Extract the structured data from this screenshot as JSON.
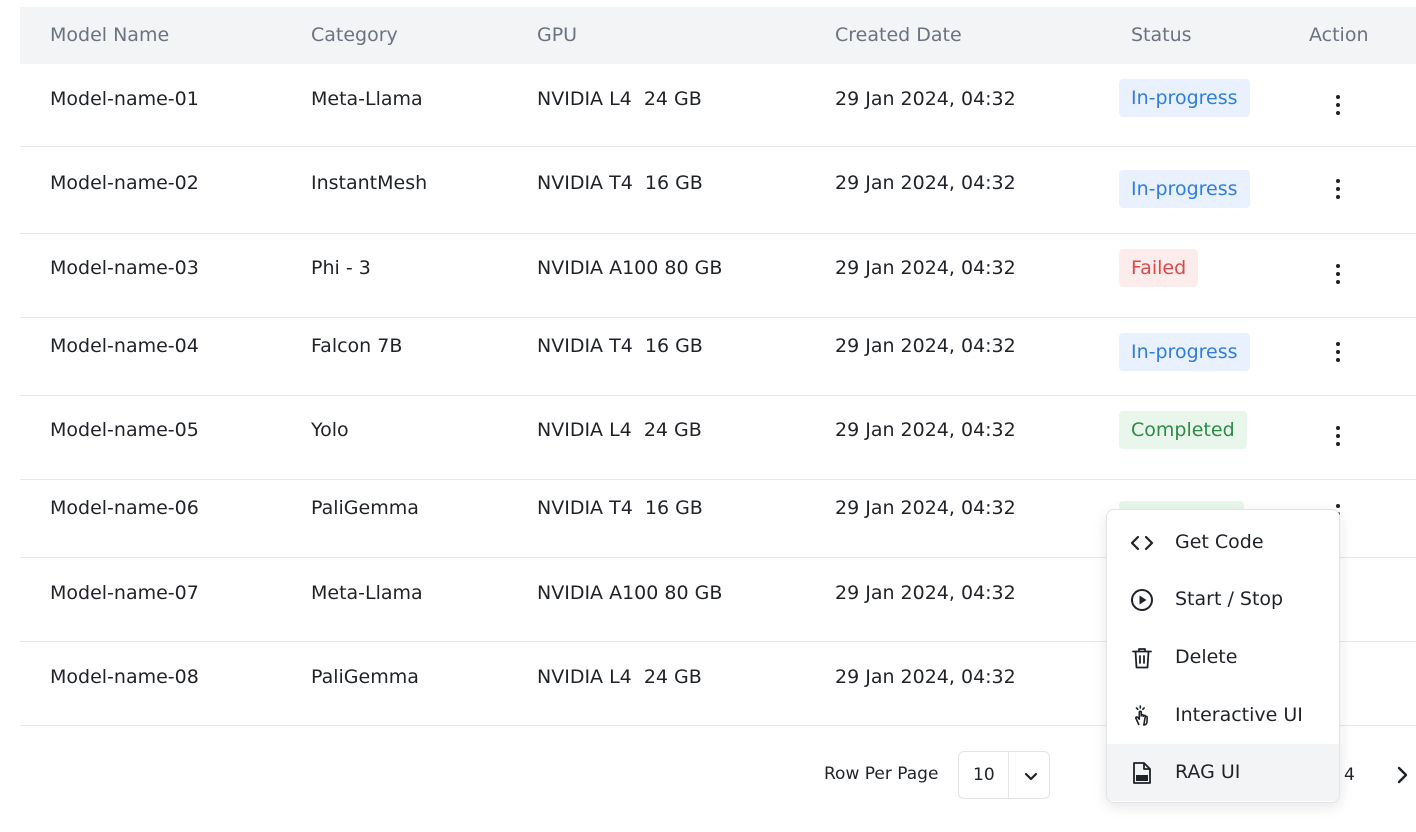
{
  "table": {
    "headers": {
      "model_name": "Model Name",
      "category": "Category",
      "gpu": "GPU",
      "created_date": "Created Date",
      "status": "Status",
      "action": "Action"
    },
    "rows": [
      {
        "model": "Model-name-01",
        "category": "Meta-Llama",
        "gpu": "NVIDIA L4  24 GB",
        "date": "29 Jan 2024, 04:32",
        "status": "In-progress"
      },
      {
        "model": "Model-name-02",
        "category": "InstantMesh",
        "gpu": "NVIDIA T4  16 GB",
        "date": "29 Jan 2024, 04:32",
        "status": "In-progress"
      },
      {
        "model": "Model-name-03",
        "category": "Phi - 3",
        "gpu": "NVIDIA A100 80 GB",
        "date": "29 Jan 2024, 04:32",
        "status": "Failed"
      },
      {
        "model": "Model-name-04",
        "category": "Falcon 7B",
        "gpu": "NVIDIA T4  16 GB",
        "date": "29 Jan 2024, 04:32",
        "status": "In-progress"
      },
      {
        "model": "Model-name-05",
        "category": "Yolo",
        "gpu": "NVIDIA L4  24 GB",
        "date": "29 Jan 2024, 04:32",
        "status": "Completed"
      },
      {
        "model": "Model-name-06",
        "category": "PaliGemma",
        "gpu": "NVIDIA T4  16 GB",
        "date": "29 Jan 2024, 04:32",
        "status": ""
      },
      {
        "model": "Model-name-07",
        "category": "Meta-Llama",
        "gpu": "NVIDIA A100 80 GB",
        "date": "29 Jan 2024, 04:32",
        "status": ""
      },
      {
        "model": "Model-name-08",
        "category": "PaliGemma",
        "gpu": "NVIDIA L4  24 GB",
        "date": "29 Jan 2024, 04:32",
        "status": ""
      }
    ]
  },
  "status_colors": {
    "In-progress": {
      "bg": "#e8f1fd",
      "fg": "#2f7de1"
    },
    "Failed": {
      "bg": "#fdecec",
      "fg": "#e04848"
    },
    "Completed": {
      "bg": "#e9f6ec",
      "fg": "#2e8b47"
    }
  },
  "pagination": {
    "row_per_page_label": "Row Per Page",
    "row_per_page_value": "10",
    "page_number": "4"
  },
  "action_menu": {
    "items": [
      {
        "label": "Get Code",
        "icon": "code-icon"
      },
      {
        "label": "Start / Stop",
        "icon": "play-circle-icon"
      },
      {
        "label": "Delete",
        "icon": "trash-icon"
      },
      {
        "label": "Interactive UI",
        "icon": "hand-pointer-icon"
      },
      {
        "label": "RAG UI",
        "icon": "rag-file-icon"
      }
    ]
  }
}
